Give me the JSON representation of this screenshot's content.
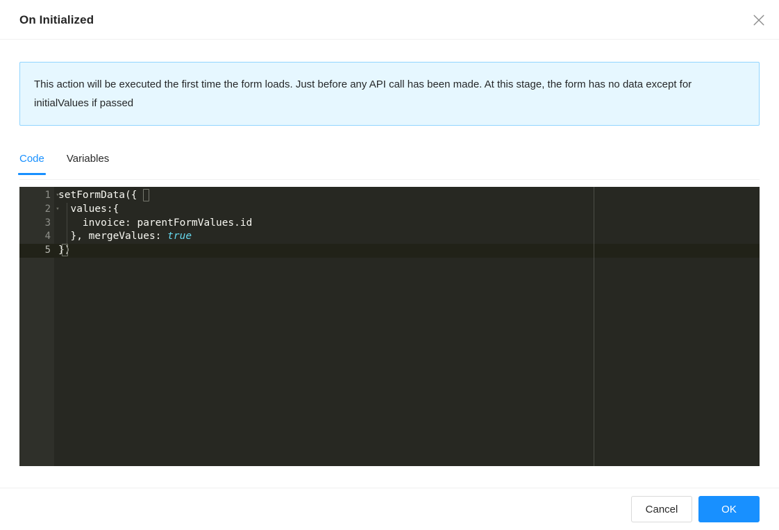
{
  "header": {
    "title": "On Initialized",
    "close_icon": "close-icon"
  },
  "banner": {
    "text": "This action will be executed the first time the form loads. Just before any API call has been made. At this stage, the form has no data except for initialValues if passed",
    "background_color": "#e6f7ff",
    "border_color": "#91d5ff"
  },
  "tabs": {
    "active_color": "#1890ff",
    "items": [
      {
        "label": "Code",
        "active": true
      },
      {
        "label": "Variables",
        "active": false
      }
    ]
  },
  "editor": {
    "theme_background": "#272822",
    "gutter_background": "#2f302a",
    "active_line_background": "#212218",
    "active_line_number": 5,
    "lines": [
      {
        "number": "1",
        "fold": "▾",
        "text": "setFormData({"
      },
      {
        "number": "2",
        "fold": "▾",
        "text": "  values:{"
      },
      {
        "number": "3",
        "fold": "",
        "text": "    invoice: parentFormValues.id"
      },
      {
        "number": "4",
        "fold": "",
        "text": "  }, mergeValues: "
      },
      {
        "number": "5",
        "fold": "",
        "text": "})"
      }
    ],
    "line4_keyword": "true",
    "keyword_color": "#66d9ef",
    "text_color": "#f8f8f2"
  },
  "footer": {
    "cancel_label": "Cancel",
    "ok_label": "OK",
    "primary_color": "#1890ff"
  }
}
